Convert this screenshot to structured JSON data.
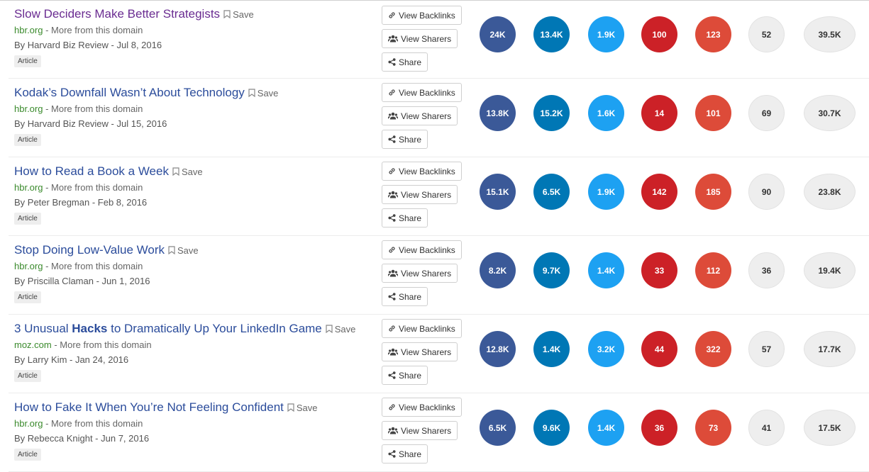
{
  "labels": {
    "save": "Save",
    "more_from_domain": " - More from this domain",
    "view_backlinks": "View Backlinks",
    "view_sharers": "View Sharers",
    "share": "Share",
    "article": "Article"
  },
  "colors": {
    "facebook": "#3b5998",
    "linkedin": "#0077b5",
    "twitter": "#1da1f2",
    "pinterest": "#cc2127",
    "reddit": "#dd4b39",
    "neutral": "#eeeeee"
  },
  "articles": [
    {
      "title": "Slow Deciders Make Better Strategists",
      "domain": "hbr.org",
      "author": "By Harvard Biz Review - Jul 8, 2016",
      "stats": [
        "24K",
        "13.4K",
        "1.9K",
        "100",
        "123",
        "52",
        "39.5K"
      ]
    },
    {
      "title": "Kodak’s Downfall Wasn’t About Technology",
      "domain": "hbr.org",
      "author": "By Harvard Biz Review - Jul 15, 2016",
      "stats": [
        "13.8K",
        "15.2K",
        "1.6K",
        "14",
        "101",
        "69",
        "30.7K"
      ]
    },
    {
      "title": "How to Read a Book a Week",
      "domain": "hbr.org",
      "author": "By Peter Bregman - Feb 8, 2016",
      "stats": [
        "15.1K",
        "6.5K",
        "1.9K",
        "142",
        "185",
        "90",
        "23.8K"
      ]
    },
    {
      "title": "Stop Doing Low-Value Work",
      "domain": "hbr.org",
      "author": "By Priscilla Claman - Jun 1, 2016",
      "stats": [
        "8.2K",
        "9.7K",
        "1.4K",
        "33",
        "112",
        "36",
        "19.4K"
      ]
    },
    {
      "title_pre": "3 Unusual ",
      "title_bold": "Hacks",
      "title_post": " to Dramatically Up Your LinkedIn Game",
      "domain": "moz.com",
      "author": "By Larry Kim - Jan 24, 2016",
      "stats": [
        "12.8K",
        "1.4K",
        "3.2K",
        "44",
        "322",
        "57",
        "17.7K"
      ]
    },
    {
      "title": "How to Fake It When You’re Not Feeling Confident",
      "domain": "hbr.org",
      "author": "By Rebecca Knight - Jun 7, 2016",
      "stats": [
        "6.5K",
        "9.6K",
        "1.4K",
        "36",
        "73",
        "41",
        "17.5K"
      ]
    }
  ]
}
